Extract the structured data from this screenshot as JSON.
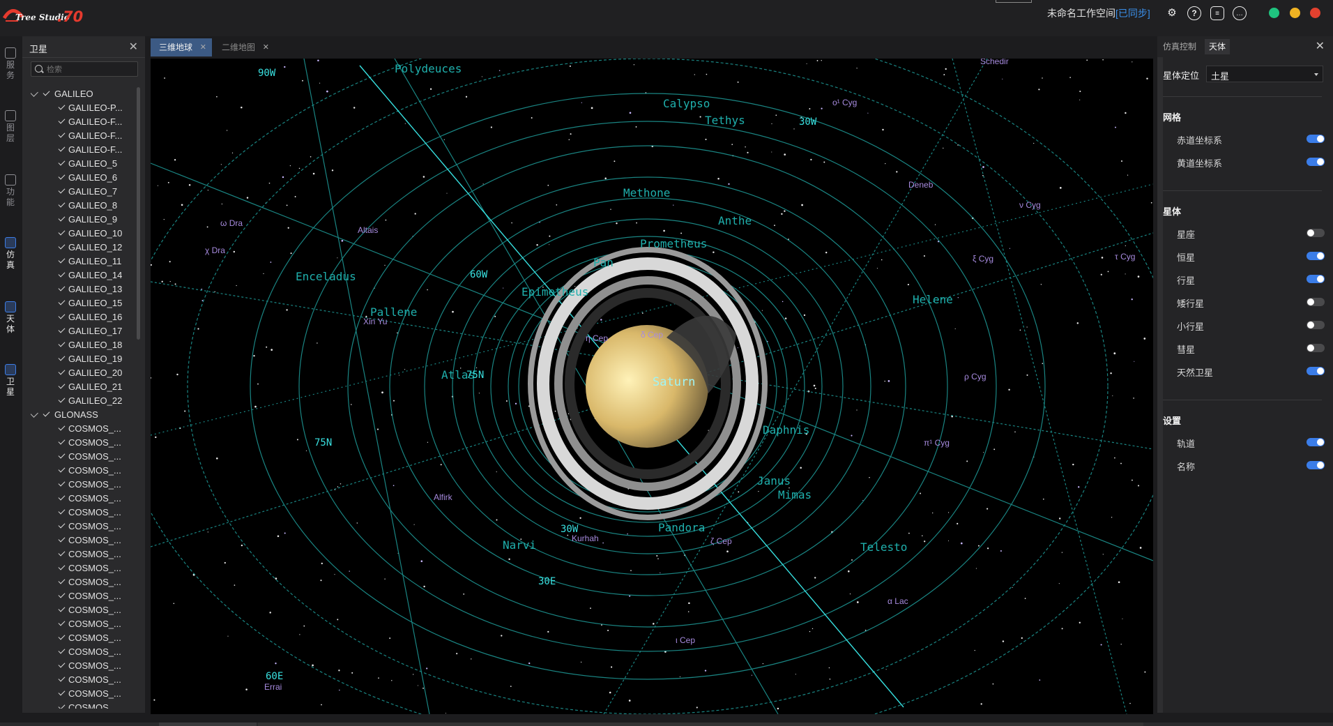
{
  "app": {
    "logo_text": "Tree Studio",
    "logo_number": ".70",
    "workspace_name": "未命名工作空间",
    "workspace_status": "[已同步]",
    "colors": {
      "accent": "#3b7de8",
      "green": "#1fc47f",
      "yellow": "#f0b323",
      "red": "#e3412f",
      "orbit": "#1f9d9a"
    }
  },
  "left_rail": [
    {
      "label": "服务",
      "icon": "cloud-server-icon"
    },
    {
      "label": "图层",
      "icon": "layers-icon"
    },
    {
      "label": "功能",
      "icon": "grid-apps-icon"
    },
    {
      "label": "仿真",
      "icon": "simulation-icon"
    },
    {
      "label": "天体",
      "icon": "sliders-icon"
    },
    {
      "label": "卫星",
      "icon": "satellite-icon"
    }
  ],
  "satellite_panel": {
    "title": "卫星",
    "search_placeholder": "检索",
    "groups": [
      {
        "name": "GALILEO",
        "items": [
          "GALILEO-P...",
          "GALILEO-F...",
          "GALILEO-F...",
          "GALILEO-F...",
          "GALILEO_5",
          "GALILEO_6",
          "GALILEO_7",
          "GALILEO_8",
          "GALILEO_9",
          "GALILEO_10",
          "GALILEO_12",
          "GALILEO_11",
          "GALILEO_14",
          "GALILEO_13",
          "GALILEO_15",
          "GALILEO_16",
          "GALILEO_17",
          "GALILEO_18",
          "GALILEO_19",
          "GALILEO_20",
          "GALILEO_21",
          "GALILEO_22"
        ]
      },
      {
        "name": "GLONASS",
        "items": [
          "COSMOS_...",
          "COSMOS_...",
          "COSMOS_...",
          "COSMOS_...",
          "COSMOS_...",
          "COSMOS_...",
          "COSMOS_...",
          "COSMOS_...",
          "COSMOS_...",
          "COSMOS_...",
          "COSMOS_...",
          "COSMOS_...",
          "COSMOS_...",
          "COSMOS_...",
          "COSMOS_...",
          "COSMOS_...",
          "COSMOS_...",
          "COSMOS_...",
          "COSMOS_...",
          "COSMOS_...",
          "COSMOS_..."
        ]
      }
    ]
  },
  "tabs": [
    {
      "label": "三维地球",
      "active": true
    },
    {
      "label": "二维地图",
      "active": false
    }
  ],
  "viewport": {
    "planet_label": "Saturn",
    "moons": [
      "Polydeuces",
      "Calypso",
      "Tethys",
      "Methone",
      "Anthe",
      "Prometheus",
      "Pan",
      "Enceladus",
      "Epimetheus",
      "Pallene",
      "Helene",
      "Atlas",
      "Daphnis",
      "Janus",
      "Mimas",
      "Pandora",
      "Telesto",
      "Narvi"
    ],
    "stars": [
      "Schedir",
      "Deneb",
      "Altais",
      "Alfirk",
      "Errai",
      "χ Dra",
      "ω Dra",
      "ξ Cyg",
      "τ Cyg",
      "ν Cyg",
      "ο¹ Cyg",
      "π¹ Cyg",
      "ρ Cyg",
      "η Cep",
      "ζ Cep",
      "ι Cep",
      "δ Cep",
      "α Lac",
      "Kurhah",
      "Xin Yu"
    ],
    "grid_labels": [
      "90W",
      "60W",
      "30W",
      "30W",
      "75N",
      "75N",
      "30E",
      "60E"
    ]
  },
  "right_panel": {
    "tabs": [
      {
        "label": "仿真控制",
        "selected": false
      },
      {
        "label": "天体",
        "selected": true
      }
    ],
    "locate_label": "星体定位",
    "locate_value": "土星",
    "sections": [
      {
        "title": "网格",
        "items": [
          {
            "label": "赤道坐标系",
            "on": true
          },
          {
            "label": "黄道坐标系",
            "on": true
          }
        ]
      },
      {
        "title": "星体",
        "items": [
          {
            "label": "星座",
            "on": false
          },
          {
            "label": "恒星",
            "on": true
          },
          {
            "label": "行星",
            "on": true
          },
          {
            "label": "矮行星",
            "on": false
          },
          {
            "label": "小行星",
            "on": false
          },
          {
            "label": "彗星",
            "on": false
          },
          {
            "label": "天然卫星",
            "on": true
          }
        ]
      },
      {
        "title": "设置",
        "items": [
          {
            "label": "轨道",
            "on": true
          },
          {
            "label": "名称",
            "on": true
          }
        ]
      }
    ]
  }
}
